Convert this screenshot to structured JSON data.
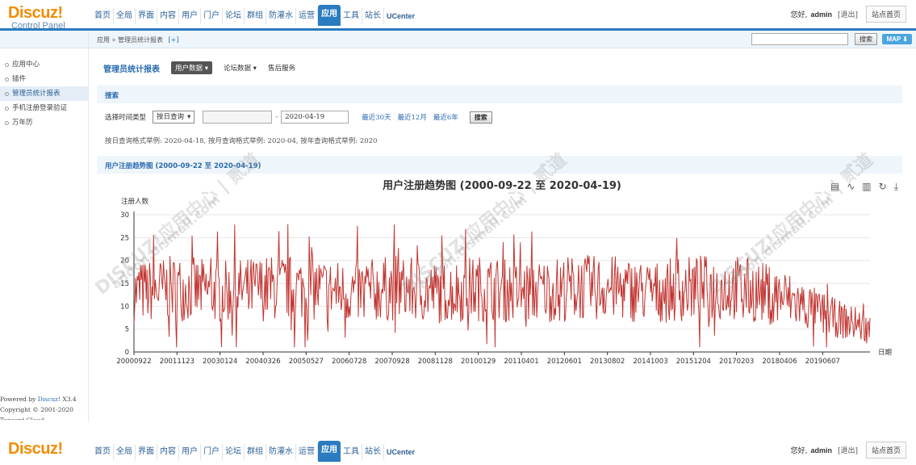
{
  "header": {
    "logo_title": "Discuz!",
    "logo_subtitle": "Control Panel",
    "nav": [
      "首页",
      "全局",
      "界面",
      "内容",
      "用户",
      "门户",
      "论坛",
      "群组",
      "防灌水",
      "运营",
      "应用",
      "工具",
      "站长",
      "UCenter"
    ],
    "active_nav": "应用",
    "greeting": "您好,",
    "user": "admin",
    "logout": "[退出]",
    "home_button": "站点首页"
  },
  "subbar": {
    "breadcrumb_root": "应用",
    "breadcrumb_sep": "»",
    "breadcrumb_current": "管理员统计报表",
    "breadcrumb_plus": "[+]",
    "search_value": "",
    "search_button": "搜索",
    "map_button": "MAP ⬇"
  },
  "sidebar": {
    "items": [
      "应用中心",
      "插件",
      "管理员统计报表",
      "手机注册登录验证",
      "万年历"
    ],
    "active_index": 2,
    "footer_line1_prefix": "Powered by ",
    "footer_line1_link": "Discuz!",
    "footer_line1_suffix": " X3.4",
    "footer_line2": "Copyright © 2001-2020",
    "footer_line3": "Tencent Cloud."
  },
  "main": {
    "title": "管理员统计报表",
    "tabs": [
      "用户数据 ▾",
      "论坛数据 ▾",
      "售后服务"
    ],
    "active_tab": 0,
    "search_section_label": "搜索",
    "time_type_label": "选择时间类型",
    "time_type_value": "按日查询",
    "start_date": "",
    "date_separator": "-",
    "end_date": "2020-04-19",
    "quick_links": [
      "最近30天",
      "最近12月",
      "最近6年"
    ],
    "search_button": "搜索",
    "hint": "按日查询格式举例: 2020-04-18, 按月查询格式举例: 2020-04, 按年查询格式举例: 2020",
    "chart_section_label": "用户注册趋势图 (2000-09-22 至 2020-04-19)"
  },
  "watermark": {
    "text1": "DISCUZ!应用中心 | 贰道",
    "text2": "addon.dismall.com"
  },
  "chart_icons": [
    "data-view-icon",
    "line-chart-icon",
    "bar-chart-icon",
    "restore-icon",
    "download-icon"
  ],
  "chart_data": {
    "type": "line",
    "title": "用户注册趋势图 (2000-09-22 至 2020-04-19)",
    "ylabel": "注册人数",
    "xlabel": "日期",
    "ylim": [
      0,
      30
    ],
    "yticks": [
      0,
      5,
      10,
      15,
      20,
      25,
      30
    ],
    "grid": true,
    "color": "#c23531",
    "x_tick_labels": [
      "20000922",
      "20011123",
      "20030124",
      "20040326",
      "20050527",
      "20060728",
      "20070928",
      "20081128",
      "20100129",
      "20110401",
      "20120601",
      "20130802",
      "20141003",
      "20151204",
      "20170203",
      "20180406",
      "20190607"
    ],
    "x": [
      "20000922",
      "20011123",
      "20030124",
      "20040326",
      "20050527",
      "20060728",
      "20070928",
      "20081128",
      "20100129",
      "20110401",
      "20120601",
      "20130802",
      "20141003",
      "20151204",
      "20170203",
      "20180406",
      "20190607",
      "20200419"
    ],
    "values": [
      13,
      14,
      13,
      14,
      14,
      13,
      14,
      13,
      14,
      13,
      14,
      14,
      13,
      14,
      14,
      12,
      8,
      5
    ],
    "series_noise_range": [
      2,
      30
    ]
  }
}
